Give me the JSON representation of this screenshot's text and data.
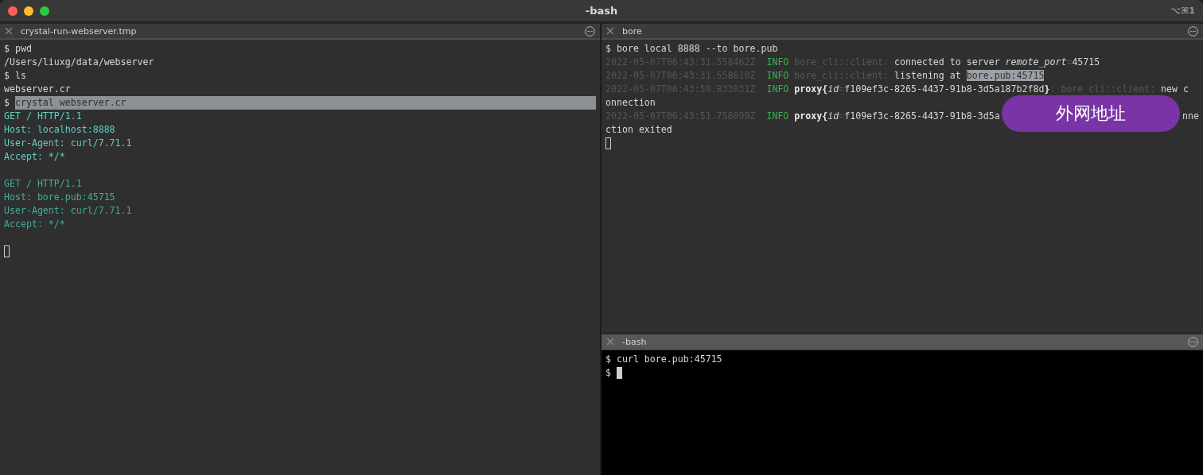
{
  "window": {
    "title": "-bash",
    "shortcut": "⌥⌘1"
  },
  "panes": [
    {
      "tab": {
        "title": "crystal-run-webserver.tmp",
        "focused": false
      },
      "lines": [
        {
          "kind": "command",
          "prompt": "$",
          "text": "pwd",
          "selected": false
        },
        {
          "kind": "output",
          "text": "/Users/liuxg/data/webserver"
        },
        {
          "kind": "command",
          "prompt": "$",
          "text": "ls",
          "selected": false
        },
        {
          "kind": "output",
          "text": "webserver.cr"
        },
        {
          "kind": "command",
          "prompt": "$",
          "text": "crystal webserver.cr",
          "selected": true
        },
        {
          "kind": "request",
          "text": "GET / HTTP/1.1"
        },
        {
          "kind": "request",
          "text": "Host: localhost:8888"
        },
        {
          "kind": "request",
          "text": "User-Agent: curl/7.71.1"
        },
        {
          "kind": "request",
          "text": "Accept: */*"
        },
        {
          "kind": "blank"
        },
        {
          "kind": "request-dim",
          "text": "GET / HTTP/1.1"
        },
        {
          "kind": "request-dim",
          "text": "Host: bore.pub:45715"
        },
        {
          "kind": "request-dim",
          "text": "User-Agent: curl/7.71.1"
        },
        {
          "kind": "request-dim",
          "text": "Accept: */*"
        },
        {
          "kind": "blank"
        },
        {
          "kind": "cursor"
        }
      ]
    },
    {
      "tab": {
        "title": "bore",
        "focused": false
      },
      "lines": [
        {
          "kind": "command",
          "prompt": "$",
          "text": "bore local 8888 --to bore.pub",
          "selected": false
        },
        {
          "kind": "log",
          "segments": [
            {
              "kind": "timestamp",
              "text": "2022-05-07T06:43:31.558462Z"
            },
            {
              "kind": "level",
              "text": "  INFO "
            },
            {
              "kind": "target",
              "text": "bore_cli::client:"
            },
            {
              "kind": "plain",
              "text": " connected to server "
            },
            {
              "kind": "italic",
              "text": "remote_port"
            },
            {
              "kind": "target",
              "text": "="
            },
            {
              "kind": "plain",
              "text": "45715"
            }
          ]
        },
        {
          "kind": "log",
          "segments": [
            {
              "kind": "timestamp",
              "text": "2022-05-07T06:43:31.558610Z"
            },
            {
              "kind": "level",
              "text": "  INFO "
            },
            {
              "kind": "target",
              "text": "bore_cli::client:"
            },
            {
              "kind": "plain",
              "text": " listening at "
            },
            {
              "kind": "selected",
              "text": "bore.pub:45715"
            }
          ]
        },
        {
          "kind": "log",
          "segments": [
            {
              "kind": "timestamp",
              "text": "2022-05-07T06:43:50.833031Z"
            },
            {
              "kind": "level",
              "text": "  INFO "
            },
            {
              "kind": "bold",
              "text": "proxy{"
            },
            {
              "kind": "italic",
              "text": "id"
            },
            {
              "kind": "target",
              "text": "="
            },
            {
              "kind": "plain",
              "text": "f109ef3c-8265-4437-91b8-3d5a187b2f8d"
            },
            {
              "kind": "bold",
              "text": "}"
            },
            {
              "kind": "target",
              "text": ": bore_cli::client:"
            },
            {
              "kind": "plain",
              "text": " new c"
            }
          ]
        },
        {
          "kind": "output",
          "text": "onnection"
        },
        {
          "kind": "log",
          "segments": [
            {
              "kind": "timestamp",
              "text": "2022-05-07T06:43:51.756099Z"
            },
            {
              "kind": "level",
              "text": "  INFO "
            },
            {
              "kind": "bold",
              "text": "proxy{"
            },
            {
              "kind": "italic",
              "text": "id"
            },
            {
              "kind": "target",
              "text": "="
            },
            {
              "kind": "plain",
              "text": "f109ef3c-8265-4437-91b8-3d5a"
            }
          ],
          "trailing": "nne"
        },
        {
          "kind": "output",
          "text": "ction exited"
        },
        {
          "kind": "cursor"
        }
      ],
      "callout": {
        "text": "外网地址"
      }
    },
    {
      "tab": {
        "title": "-bash",
        "focused": true
      },
      "lines": [
        {
          "kind": "command",
          "prompt": "$",
          "text": "curl bore.pub:45715",
          "selected": false
        },
        {
          "kind": "block-cursor",
          "prompt": "$"
        }
      ]
    }
  ]
}
